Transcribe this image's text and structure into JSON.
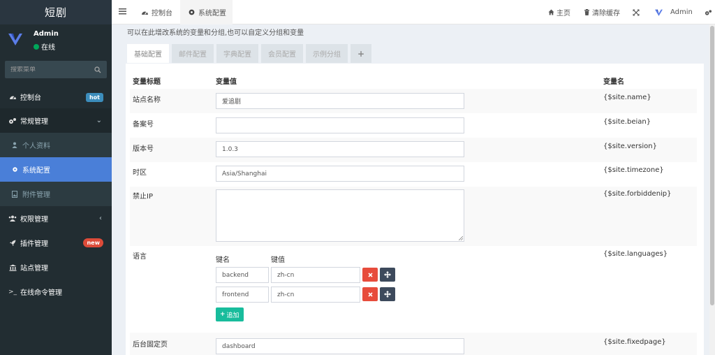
{
  "sidebar": {
    "brand": "短剧",
    "user": {
      "name": "Admin",
      "status": "在线"
    },
    "search_placeholder": "搜索菜单",
    "menu": [
      {
        "label": "控制台",
        "badge": "hot"
      },
      {
        "label": "常规管理"
      },
      {
        "label": "个人资料"
      },
      {
        "label": "系统配置"
      },
      {
        "label": "附件管理"
      },
      {
        "label": "权限管理"
      },
      {
        "label": "插件管理",
        "badge": "new"
      },
      {
        "label": "站点管理"
      },
      {
        "label": "在线命令管理"
      }
    ]
  },
  "topbar": {
    "tabs": [
      {
        "label": "控制台"
      },
      {
        "label": "系统配置"
      }
    ],
    "home": "主页",
    "clear_cache": "清除缓存",
    "user": "Admin"
  },
  "content": {
    "intro": "可以在此增改系统的变量和分组,也可以自定义分组和变量",
    "tabs": [
      "基础配置",
      "邮件配置",
      "字典配置",
      "会员配置",
      "示例分组",
      "+"
    ],
    "headers": {
      "title": "变量标题",
      "value": "变量值",
      "name": "变量名"
    },
    "rows": [
      {
        "title": "站点名称",
        "value": "爱追剧",
        "name": "{$site.name}"
      },
      {
        "title": "备案号",
        "value": "",
        "name": "{$site.beian}"
      },
      {
        "title": "版本号",
        "value": "1.0.3",
        "name": "{$site.version}"
      },
      {
        "title": "时区",
        "value": "Asia/Shanghai",
        "name": "{$site.timezone}"
      },
      {
        "title": "禁止IP",
        "value": "",
        "name": "{$site.forbiddenip}"
      },
      {
        "title": "语言",
        "name": "{$site.languages}"
      },
      {
        "title": "后台固定页",
        "value": "dashboard",
        "name": "{$site.fixedpage}"
      }
    ],
    "languages": {
      "key_label": "键名",
      "value_label": "键值",
      "items": [
        {
          "key": "backend",
          "value": "zh-cn"
        },
        {
          "key": "frontend",
          "value": "zh-cn"
        }
      ],
      "add_label": "追加"
    }
  },
  "colors": {
    "sidebar_bg": "#222d32",
    "active_item": "#4a7fd8",
    "danger": "#e74c3c",
    "success": "#18bc9c"
  }
}
